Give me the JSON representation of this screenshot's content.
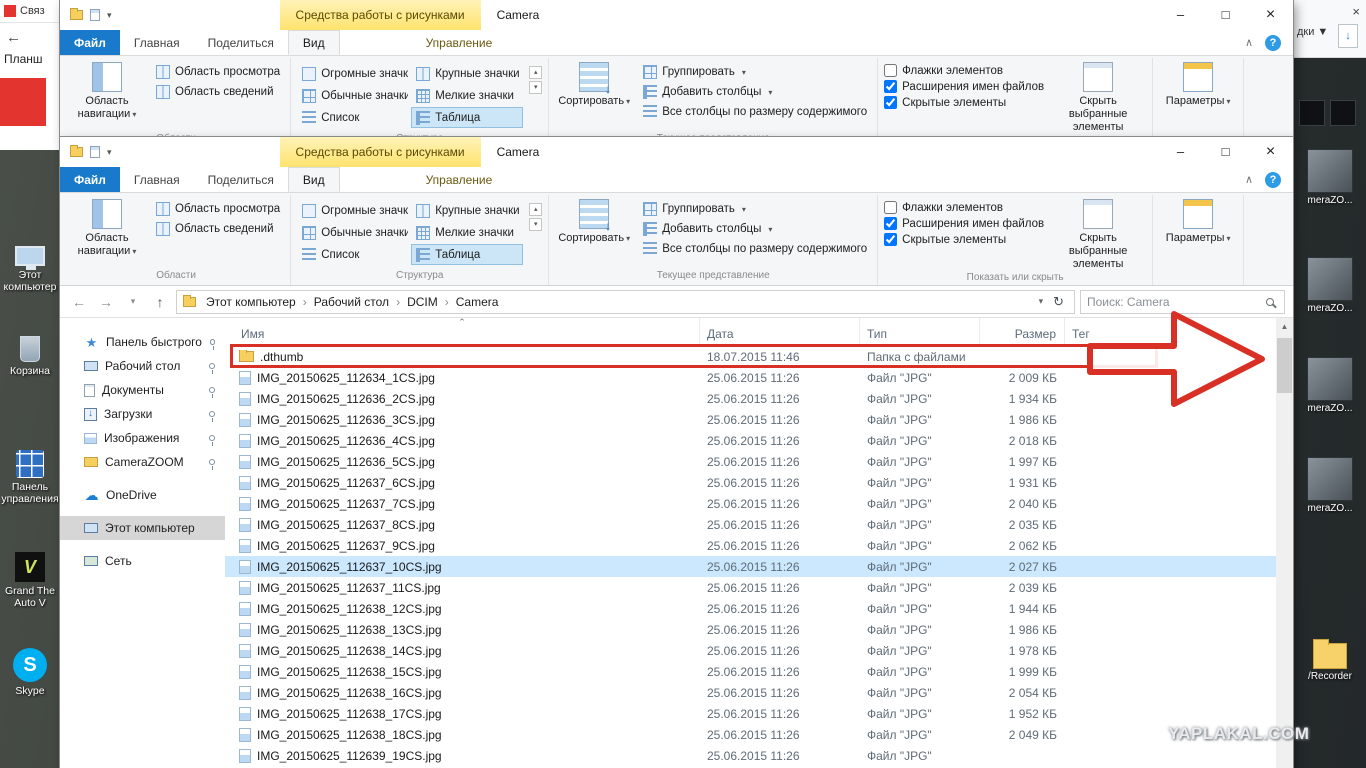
{
  "glyphs": {
    "minimize": "–",
    "maximize": "□",
    "close": "×",
    "back": "←",
    "forward": "→",
    "up": "↑",
    "down": "↓",
    "dropdown": "▾",
    "refresh": "↻",
    "collapse": "∧",
    "help": "?",
    "crumb_sep": "›",
    "sort_caret": "ˆ",
    "scroll_up": "▲",
    "spin_up": "▴",
    "spin_down": "▾"
  },
  "back_left": {
    "tab_label": "Связ",
    "page_label": "Планш"
  },
  "desktop": {
    "left_icons": [
      {
        "label": "Этот компьютер",
        "icon": "computer"
      },
      {
        "label": "Корзина",
        "icon": "recycle"
      },
      {
        "label": "Панель управления",
        "icon": "control"
      },
      {
        "label": "Grand The Auto V",
        "icon": "gta"
      },
      {
        "label": "Skype",
        "icon": "skype"
      }
    ],
    "right_top": {
      "close": "×",
      "label": "дки ▼",
      "download": "↓"
    },
    "right_items": [
      {
        "label": "meraZO...",
        "icon": "thumb"
      },
      {
        "label": "meraZO...",
        "icon": "thumb"
      },
      {
        "label": "meraZO...",
        "icon": "thumb"
      },
      {
        "label": "meraZO...",
        "icon": "thumb"
      },
      {
        "label": "/Recorder",
        "icon": "folder"
      }
    ],
    "watermark": "YAPLAKAL.COM"
  },
  "window": {
    "title": "Camera",
    "contextual_tab": "Средства работы с рисунками",
    "tabs": [
      {
        "label": "Файл",
        "file": true
      },
      {
        "label": "Главная"
      },
      {
        "label": "Поделиться"
      },
      {
        "label": "Вид",
        "active": true
      },
      {
        "label": "Управление",
        "contextual": true
      }
    ],
    "ribbon": {
      "nav_pane": {
        "label": "Область навигации"
      },
      "pane_buttons": [
        {
          "label": "Область просмотра",
          "icon": "lg"
        },
        {
          "label": "Область сведений",
          "icon": "lg"
        }
      ],
      "group_panes": "Области",
      "layout": [
        {
          "label": "Огромные значки",
          "icon": "xl"
        },
        {
          "label": "Крупные значки",
          "icon": "lg"
        },
        {
          "label": "Обычные значки",
          "icon": "md"
        },
        {
          "label": "Мелкие значки",
          "icon": "sm"
        },
        {
          "label": "Список",
          "icon": "list"
        },
        {
          "label": "Таблица",
          "icon": "table",
          "selected": true
        }
      ],
      "group_layout": "Структура",
      "sort": {
        "label": "Сортировать"
      },
      "view_buttons": [
        {
          "label": "Группировать",
          "icon": "md",
          "dropdown": true
        },
        {
          "label": "Добавить столбцы",
          "icon": "table",
          "dropdown": true
        },
        {
          "label": "Все столбцы по размеру содержимого",
          "icon": "list"
        }
      ],
      "group_view": "Текущее представление",
      "toggles": [
        {
          "label": "Флажки элементов",
          "checked": false
        },
        {
          "label": "Расширения имен файлов",
          "checked": true
        },
        {
          "label": "Скрытые элементы",
          "checked": true
        }
      ],
      "hide_button": "Скрыть выбранные элементы",
      "group_showhide": "Показать или скрыть",
      "options": {
        "label": "Параметры"
      }
    },
    "addressbar": {
      "breadcrumb": [
        {
          "label": "Этот компьютер"
        },
        {
          "label": "Рабочий стол"
        },
        {
          "label": "DCIM"
        },
        {
          "label": "Camera"
        }
      ],
      "search_placeholder": "Поиск: Camera"
    },
    "nav": [
      {
        "label": "Панель быстрого до",
        "icon": "star",
        "pinned": true
      },
      {
        "label": "Рабочий стол",
        "icon": "desktop",
        "pinned": true
      },
      {
        "label": "Документы",
        "icon": "documents",
        "pinned": true
      },
      {
        "label": "Загрузки",
        "icon": "downloads",
        "pinned": true
      },
      {
        "label": "Изображения",
        "icon": "pictures",
        "pinned": true
      },
      {
        "label": "CameraZOOM",
        "icon": "folder",
        "pinned": true
      },
      {
        "label": "OneDrive",
        "icon": "cloud",
        "gap": true
      },
      {
        "label": "Этот компьютер",
        "icon": "computer",
        "selected": true,
        "gap": true
      },
      {
        "label": "Сеть",
        "icon": "network",
        "gap": true
      }
    ],
    "list": {
      "columns": [
        {
          "label": "Имя",
          "key": "name",
          "sorted": true
        },
        {
          "label": "Дата",
          "key": "date"
        },
        {
          "label": "Тип",
          "key": "type"
        },
        {
          "label": "Размер",
          "key": "size"
        },
        {
          "label": "Тег",
          "key": "tag"
        }
      ],
      "rows": [
        {
          "name": ".dthumb",
          "date": "18.07.2015 11:46",
          "type": "Папка с файлами",
          "size": "",
          "icon": "folder",
          "annotated": true
        },
        {
          "name": "IMG_20150625_112634_1CS.jpg",
          "date": "25.06.2015 11:26",
          "type": "Файл \"JPG\"",
          "size": "2 009 КБ",
          "icon": "image"
        },
        {
          "name": "IMG_20150625_112636_2CS.jpg",
          "date": "25.06.2015 11:26",
          "type": "Файл \"JPG\"",
          "size": "1 934 КБ",
          "icon": "image"
        },
        {
          "name": "IMG_20150625_112636_3CS.jpg",
          "date": "25.06.2015 11:26",
          "type": "Файл \"JPG\"",
          "size": "1 986 КБ",
          "icon": "image"
        },
        {
          "name": "IMG_20150625_112636_4CS.jpg",
          "date": "25.06.2015 11:26",
          "type": "Файл \"JPG\"",
          "size": "2 018 КБ",
          "icon": "image"
        },
        {
          "name": "IMG_20150625_112636_5CS.jpg",
          "date": "25.06.2015 11:26",
          "type": "Файл \"JPG\"",
          "size": "1 997 КБ",
          "icon": "image"
        },
        {
          "name": "IMG_20150625_112637_6CS.jpg",
          "date": "25.06.2015 11:26",
          "type": "Файл \"JPG\"",
          "size": "1 931 КБ",
          "icon": "image"
        },
        {
          "name": "IMG_20150625_112637_7CS.jpg",
          "date": "25.06.2015 11:26",
          "type": "Файл \"JPG\"",
          "size": "2 040 КБ",
          "icon": "image"
        },
        {
          "name": "IMG_20150625_112637_8CS.jpg",
          "date": "25.06.2015 11:26",
          "type": "Файл \"JPG\"",
          "size": "2 035 КБ",
          "icon": "image"
        },
        {
          "name": "IMG_20150625_112637_9CS.jpg",
          "date": "25.06.2015 11:26",
          "type": "Файл \"JPG\"",
          "size": "2 062 КБ",
          "icon": "image"
        },
        {
          "name": "IMG_20150625_112637_10CS.jpg",
          "date": "25.06.2015 11:26",
          "type": "Файл \"JPG\"",
          "size": "2 027 КБ",
          "icon": "image",
          "selected": true
        },
        {
          "name": "IMG_20150625_112637_11CS.jpg",
          "date": "25.06.2015 11:26",
          "type": "Файл \"JPG\"",
          "size": "2 039 КБ",
          "icon": "image"
        },
        {
          "name": "IMG_20150625_112638_12CS.jpg",
          "date": "25.06.2015 11:26",
          "type": "Файл \"JPG\"",
          "size": "1 944 КБ",
          "icon": "image"
        },
        {
          "name": "IMG_20150625_112638_13CS.jpg",
          "date": "25.06.2015 11:26",
          "type": "Файл \"JPG\"",
          "size": "1 986 КБ",
          "icon": "image"
        },
        {
          "name": "IMG_20150625_112638_14CS.jpg",
          "date": "25.06.2015 11:26",
          "type": "Файл \"JPG\"",
          "size": "1 978 КБ",
          "icon": "image"
        },
        {
          "name": "IMG_20150625_112638_15CS.jpg",
          "date": "25.06.2015 11:26",
          "type": "Файл \"JPG\"",
          "size": "1 999 КБ",
          "icon": "image"
        },
        {
          "name": "IMG_20150625_112638_16CS.jpg",
          "date": "25.06.2015 11:26",
          "type": "Файл \"JPG\"",
          "size": "2 054 КБ",
          "icon": "image"
        },
        {
          "name": "IMG_20150625_112638_17CS.jpg",
          "date": "25.06.2015 11:26",
          "type": "Файл \"JPG\"",
          "size": "1 952 КБ",
          "icon": "image"
        },
        {
          "name": "IMG_20150625_112638_18CS.jpg",
          "date": "25.06.2015 11:26",
          "type": "Файл \"JPG\"",
          "size": "2 049 КБ",
          "icon": "image"
        },
        {
          "name": "IMG_20150625_112639_19CS.jpg",
          "date": "25.06.2015 11:26",
          "type": "Файл \"JPG\"",
          "size": "",
          "icon": "image"
        }
      ]
    }
  }
}
